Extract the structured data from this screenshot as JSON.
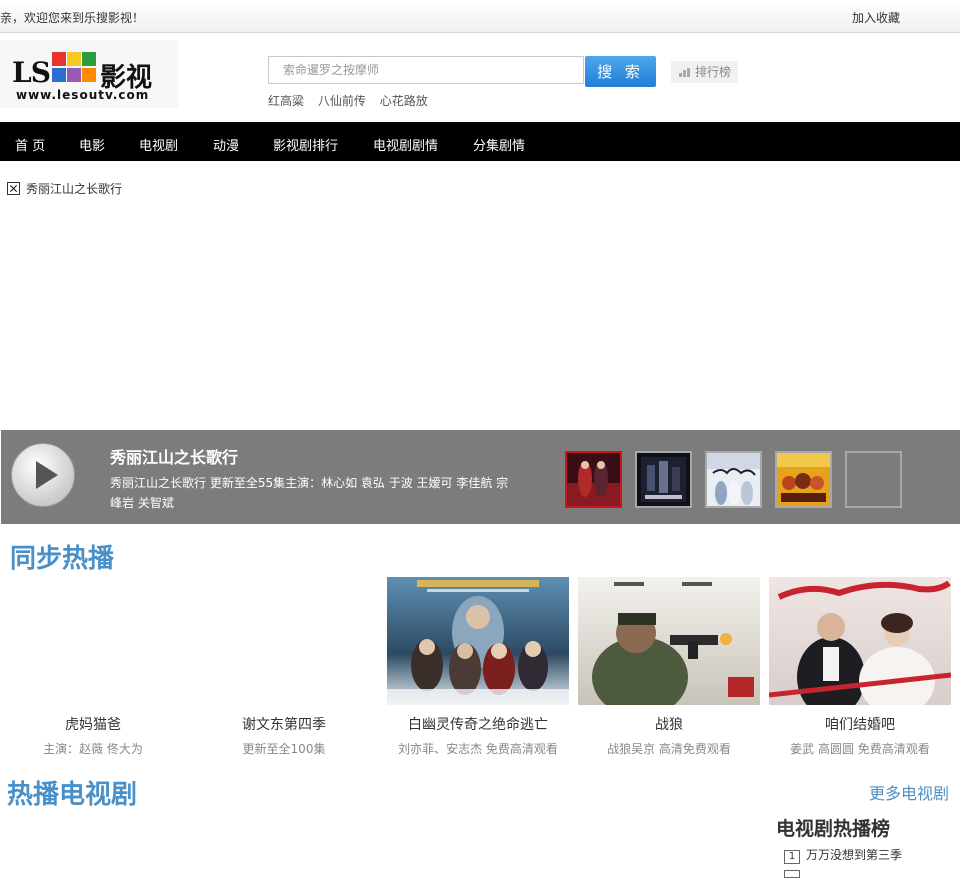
{
  "topbar": {
    "welcome": "亲，欢迎您来到乐搜影视！",
    "favorite": "加入收藏"
  },
  "logo": {
    "mark": "LS",
    "name": "影视",
    "url": "www.lesoutv.com"
  },
  "search": {
    "placeholder": "索命暹罗之按摩师",
    "button": "搜 索",
    "ranking": "排行榜"
  },
  "hotwords": [
    "红高粱",
    "八仙前传",
    "心花路放"
  ],
  "nav": [
    "首 页",
    "电影",
    "电视剧",
    "动漫",
    "影视剧排行",
    "电视剧剧情",
    "分集剧情"
  ],
  "broken_image": {
    "alt": "秀丽江山之长歌行"
  },
  "featured": {
    "title": "秀丽江山之长歌行",
    "description": "秀丽江山之长歌行  更新至全55集主演：林心如  袁弘  于波  王嫒可  李佳航  宗峰岩  关智斌",
    "thumbnails": [
      "thumb-1",
      "thumb-2",
      "thumb-3",
      "thumb-4",
      "thumb-5"
    ]
  },
  "sections": {
    "sync": {
      "title": "同步热播",
      "cards": [
        {
          "title": "虎妈猫爸",
          "sub": "主演：赵薇  佟大为"
        },
        {
          "title": "谢文东第四季",
          "sub": "更新至全100集"
        },
        {
          "title": "白幽灵传奇之绝命逃亡",
          "sub": "刘亦菲、安志杰  免费高清观看"
        },
        {
          "title": "战狼",
          "sub": "战狼吴京  高清免费观看"
        },
        {
          "title": "咱们结婚吧",
          "sub": "姜武  高圆圆  免费高清观看"
        }
      ]
    },
    "tv": {
      "title": "热播电视剧",
      "more": "更多电视剧",
      "rank_title": "电视剧热播榜",
      "rank": [
        {
          "num": "1",
          "title": "万万没想到第三季"
        }
      ]
    }
  },
  "colors": {
    "accent": "#4a90c8",
    "nav": "#000000",
    "search_button": "#1f7fd6",
    "featured_bar": "#7c7c7c"
  }
}
